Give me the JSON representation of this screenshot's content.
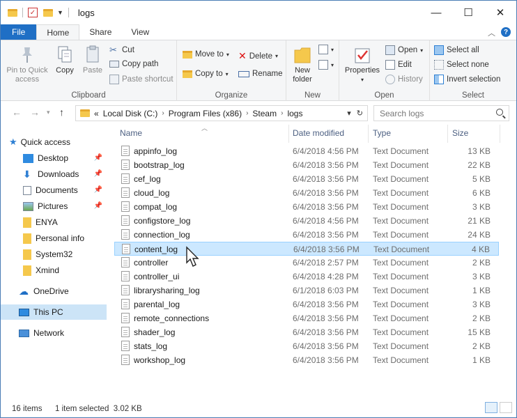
{
  "window": {
    "title": "logs",
    "controls": {
      "minimize": "—",
      "maximize": "☐",
      "close": "✕"
    }
  },
  "ribbon_tabs": [
    "File",
    "Home",
    "Share",
    "View"
  ],
  "ribbon": {
    "clipboard": {
      "label": "Clipboard",
      "pin": "Pin to Quick access",
      "pin_l1": "Pin to Quick",
      "pin_l2": "access",
      "copy": "Copy",
      "paste": "Paste",
      "cut": "Cut",
      "copy_path": "Copy path",
      "paste_shortcut": "Paste shortcut"
    },
    "organize": {
      "label": "Organize",
      "move_to": "Move to",
      "copy_to": "Copy to",
      "delete": "Delete",
      "rename": "Rename"
    },
    "new": {
      "label": "New",
      "new_folder_l1": "New",
      "new_folder_l2": "folder"
    },
    "open": {
      "label": "Open",
      "properties": "Properties",
      "open": "Open",
      "edit": "Edit",
      "history": "History"
    },
    "select": {
      "label": "Select",
      "select_all": "Select all",
      "select_none": "Select none",
      "invert": "Invert selection"
    }
  },
  "address": {
    "prefix": "«",
    "crumbs": [
      "Local Disk (C:)",
      "Program Files (x86)",
      "Steam",
      "logs"
    ],
    "search_placeholder": "Search logs"
  },
  "nav": {
    "quick_access": "Quick access",
    "items": [
      "Desktop",
      "Downloads",
      "Documents",
      "Pictures",
      "ENYA",
      "Personal info",
      "System32",
      "Xmind"
    ],
    "onedrive": "OneDrive",
    "this_pc": "This PC",
    "network": "Network"
  },
  "columns": {
    "name": "Name",
    "date": "Date modified",
    "type": "Type",
    "size": "Size"
  },
  "files": [
    {
      "name": "appinfo_log",
      "date": "6/4/2018 4:56 PM",
      "type": "Text Document",
      "size": "13 KB"
    },
    {
      "name": "bootstrap_log",
      "date": "6/4/2018 3:56 PM",
      "type": "Text Document",
      "size": "22 KB"
    },
    {
      "name": "cef_log",
      "date": "6/4/2018 3:56 PM",
      "type": "Text Document",
      "size": "5 KB"
    },
    {
      "name": "cloud_log",
      "date": "6/4/2018 3:56 PM",
      "type": "Text Document",
      "size": "6 KB"
    },
    {
      "name": "compat_log",
      "date": "6/4/2018 3:56 PM",
      "type": "Text Document",
      "size": "3 KB"
    },
    {
      "name": "configstore_log",
      "date": "6/4/2018 4:56 PM",
      "type": "Text Document",
      "size": "21 KB"
    },
    {
      "name": "connection_log",
      "date": "6/4/2018 3:56 PM",
      "type": "Text Document",
      "size": "24 KB"
    },
    {
      "name": "content_log",
      "date": "6/4/2018 3:56 PM",
      "type": "Text Document",
      "size": "4 KB"
    },
    {
      "name": "controller",
      "date": "6/4/2018 2:57 PM",
      "type": "Text Document",
      "size": "2 KB"
    },
    {
      "name": "controller_ui",
      "date": "6/4/2018 4:28 PM",
      "type": "Text Document",
      "size": "3 KB"
    },
    {
      "name": "librarysharing_log",
      "date": "6/1/2018 6:03 PM",
      "type": "Text Document",
      "size": "1 KB"
    },
    {
      "name": "parental_log",
      "date": "6/4/2018 3:56 PM",
      "type": "Text Document",
      "size": "3 KB"
    },
    {
      "name": "remote_connections",
      "date": "6/4/2018 3:56 PM",
      "type": "Text Document",
      "size": "2 KB"
    },
    {
      "name": "shader_log",
      "date": "6/4/2018 3:56 PM",
      "type": "Text Document",
      "size": "15 KB"
    },
    {
      "name": "stats_log",
      "date": "6/4/2018 3:56 PM",
      "type": "Text Document",
      "size": "2 KB"
    },
    {
      "name": "workshop_log",
      "date": "6/4/2018 3:56 PM",
      "type": "Text Document",
      "size": "1 KB"
    }
  ],
  "selected_file": "content_log",
  "status": {
    "count": "16 items",
    "selection": "1 item selected  3.02 KB"
  },
  "colors": {
    "accent": "#1f6fc5",
    "selected_row": "#cce8ff",
    "selected_nav": "#cce4f7",
    "folder": "#f5c84c"
  }
}
